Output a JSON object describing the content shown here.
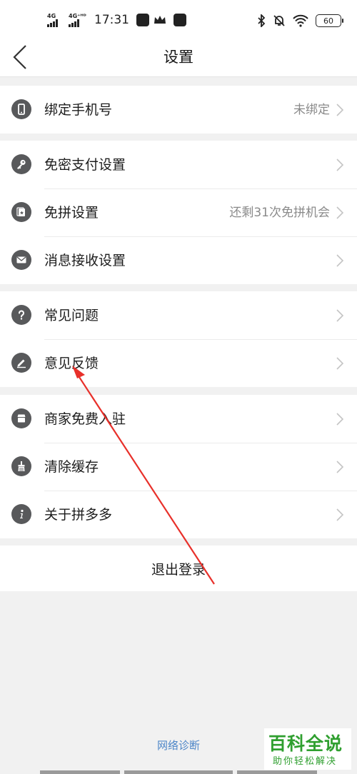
{
  "status_bar": {
    "signal1_label": "4G",
    "signal2_label": "4G⁺ᴴᴰ",
    "time": "17:31",
    "battery": "60"
  },
  "nav": {
    "title": "设置"
  },
  "sections": [
    [
      {
        "label": "绑定手机号",
        "value": "未绑定",
        "icon": "phone-icon"
      }
    ],
    [
      {
        "label": "免密支付设置",
        "value": "",
        "icon": "key-icon"
      },
      {
        "label": "免拼设置",
        "value": "还剩31次免拼机会",
        "icon": "card-icon"
      },
      {
        "label": "消息接收设置",
        "value": "",
        "icon": "envelope-icon"
      }
    ],
    [
      {
        "label": "常见问题",
        "value": "",
        "icon": "question-icon"
      },
      {
        "label": "意见反馈",
        "value": "",
        "icon": "pencil-icon"
      }
    ],
    [
      {
        "label": "商家免费入驻",
        "value": "",
        "icon": "store-icon"
      },
      {
        "label": "清除缓存",
        "value": "",
        "icon": "broom-icon"
      },
      {
        "label": "关于拼多多",
        "value": "",
        "icon": "info-icon"
      }
    ]
  ],
  "logout_label": "退出登录",
  "network_diag_label": "网络诊断",
  "watermark": {
    "title": "百科全说",
    "subtitle": "助你轻松解决"
  },
  "colors": {
    "icon_bg": "#58595b",
    "link": "#4d86c8",
    "annotation_arrow": "#e8302a",
    "watermark": "#2f9f2f"
  }
}
